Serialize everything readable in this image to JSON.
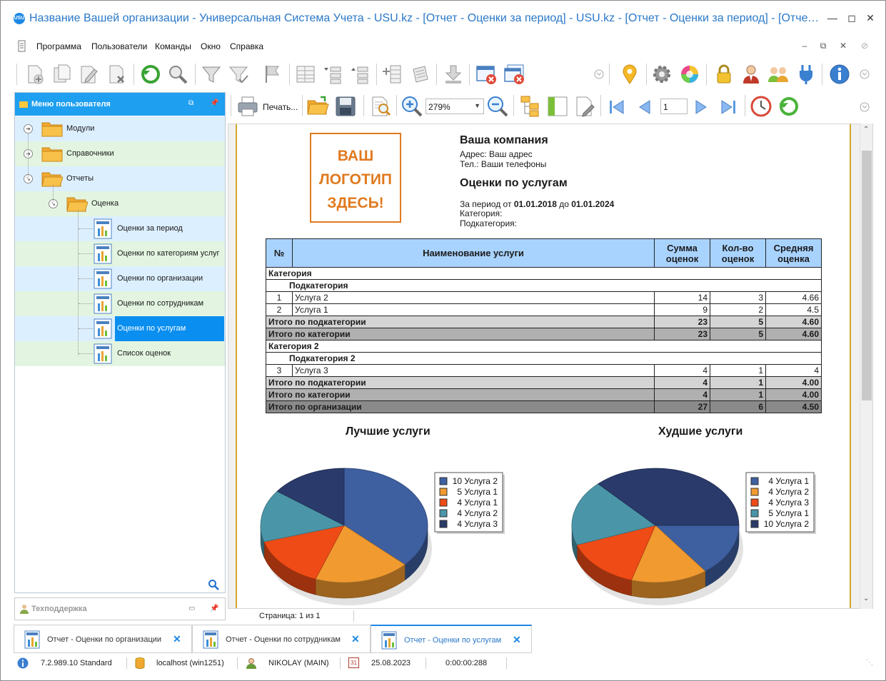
{
  "window": {
    "title": "Название Вашей организации - Универсальная Система Учета - USU.kz - [Отчет - Оценки за период] - USU.kz - [Отчет - Оценки за период] - [Отчет - Оц...",
    "app_icon_text": "USU"
  },
  "menu": {
    "items": [
      "Программа",
      "Пользователи",
      "Команды",
      "Окно",
      "Справка"
    ]
  },
  "left_panel": {
    "title": "Меню пользователя",
    "tree": {
      "modules": "Модули",
      "directories": "Справочники",
      "reports": "Отчеты",
      "rating": "Оценка",
      "reports_list": [
        "Оценки за период",
        "Оценки по категориям услуг",
        "Оценки по организации",
        "Оценки по сотрудникам",
        "Оценки по услугам",
        "Список оценок"
      ]
    }
  },
  "support_panel": {
    "title": "Техподдержка"
  },
  "report_toolbar": {
    "print_label": "Печать...",
    "zoom_value": "279%",
    "page_value": "1"
  },
  "report": {
    "logo_text": "ВАШ ЛОГОТИП ЗДЕСЬ!",
    "company": "Ваша компания",
    "address": "Адрес: Ваш адрес",
    "phone": "Тел.: Ваши телефоны",
    "title": "Оценки по услугам",
    "period_prefix": "За период от",
    "period_from": "01.01.2018",
    "period_mid": "до",
    "period_to": "01.01.2024",
    "category_label": "Категория:",
    "subcategory_label": "Подкатегория:",
    "table": {
      "headers": [
        "№",
        "Наименование услуги",
        "Сумма оценок",
        "Кол-во оценок",
        "Средняя оценка"
      ],
      "cat1": "Категория",
      "sub1": "Подкатегория",
      "rows1": [
        {
          "n": "1",
          "name": "Услуга 2",
          "sum": "14",
          "cnt": "3",
          "avg": "4.66"
        },
        {
          "n": "2",
          "name": "Услуга 1",
          "sum": "9",
          "cnt": "2",
          "avg": "4.5"
        }
      ],
      "tsub1": {
        "label": "Итого по подкатегории",
        "sum": "23",
        "cnt": "5",
        "avg": "4.60"
      },
      "tcat1": {
        "label": "Итого по категории",
        "sum": "23",
        "cnt": "5",
        "avg": "4.60"
      },
      "cat2": "Категория 2",
      "sub2": "Подкатегория 2",
      "rows2": [
        {
          "n": "3",
          "name": "Услуга 3",
          "sum": "4",
          "cnt": "1",
          "avg": "4"
        }
      ],
      "tsub2": {
        "label": "Итого по подкатегории",
        "sum": "4",
        "cnt": "1",
        "avg": "4.00"
      },
      "tcat2": {
        "label": "Итого по категории",
        "sum": "4",
        "cnt": "1",
        "avg": "4.00"
      },
      "torg": {
        "label": "Итого по организации",
        "sum": "27",
        "cnt": "6",
        "avg": "4.50"
      }
    }
  },
  "chart_data": [
    {
      "type": "pie",
      "title": "Лучшие услуги",
      "categories": [
        "10 Услуга 2",
        "5 Услуга 1",
        "4 Услуга 1",
        "4 Услуга 2",
        "4 Услуга 3"
      ],
      "values": [
        10,
        5,
        4,
        4,
        4
      ],
      "colors": [
        "#3e5fa0",
        "#f09a30",
        "#ef4b16",
        "#4a96a8",
        "#2a3a6a"
      ],
      "legend": "right"
    },
    {
      "type": "pie",
      "title": "Худшие услуги",
      "categories": [
        "4 Услуга 1",
        "4 Услуга 2",
        "4 Услуга 3",
        "5 Услуга 1",
        "10 Услуга 2"
      ],
      "values": [
        4,
        4,
        4,
        5,
        10
      ],
      "colors": [
        "#3e5fa0",
        "#f09a30",
        "#ef4b16",
        "#4a96a8",
        "#2a3a6a"
      ],
      "legend": "right"
    }
  ],
  "page_status": "Страница: 1 из 1",
  "tabs": [
    {
      "label": "Отчет - Оценки по организации"
    },
    {
      "label": "Отчет - Оценки по сотрудникам"
    },
    {
      "label": "Отчет - Оценки по услугам"
    }
  ],
  "status": {
    "version": "7.2.989.10 Standard",
    "server": "localhost (win1251)",
    "user": "NIKOLAY (MAIN)",
    "date": "25.08.2023",
    "timer": "0:00:00:288",
    "calendar_day": "31"
  }
}
